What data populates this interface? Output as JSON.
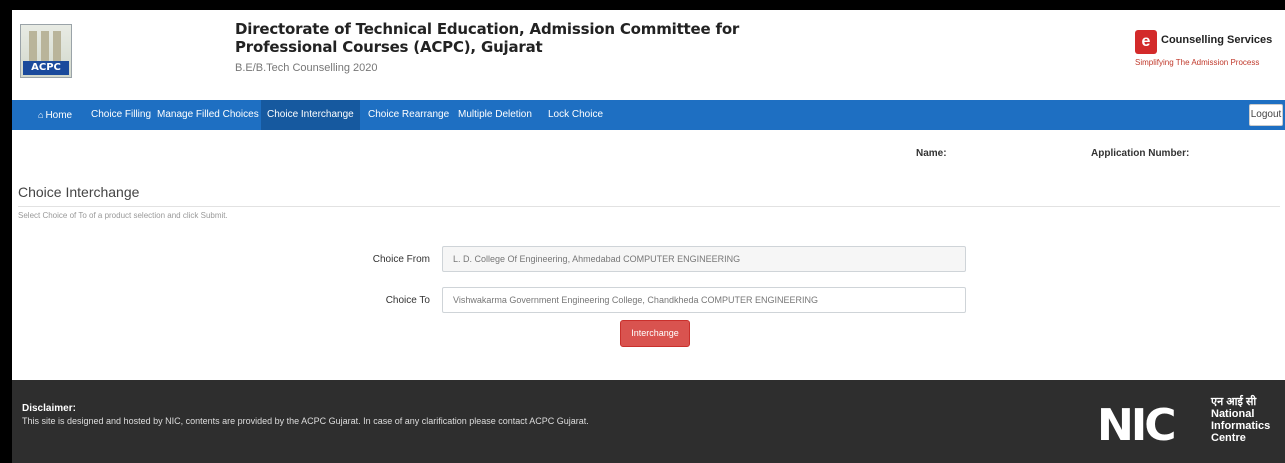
{
  "header": {
    "logo_text": "ACPC",
    "title_line1": "Directorate of Technical Education, Admission Committee for",
    "title_line2": "Professional Courses (ACPC), Gujarat",
    "subtitle": "B.E/B.Tech Counselling 2020",
    "service_badge": "e",
    "service_title": "Counselling Services",
    "service_tagline": "Simplifying The Admission Process"
  },
  "nav": {
    "items": [
      {
        "label": "Home",
        "icon": "home-icon"
      },
      {
        "label": "Choice Filling"
      },
      {
        "label": "Manage Filled Choices"
      },
      {
        "label": "Choice Interchange"
      },
      {
        "label": "Choice Rearrange"
      },
      {
        "label": "Multiple Deletion"
      },
      {
        "label": "Lock Choice"
      }
    ],
    "logout_label": "Logout",
    "accent": "#1e6fc2"
  },
  "candidate": {
    "name_label": "Name:",
    "application_label": "Application Number:"
  },
  "main": {
    "section_title": "Choice Interchange",
    "hint": "Select Choice of To of a product selection and click Submit.",
    "choice_from_label": "Choice From",
    "choice_from_value": "L. D. College Of Engineering, Ahmedabad COMPUTER ENGINEERING",
    "choice_to_label": "Choice To",
    "choice_to_value": "Vishwakarma Government Engineering College, Chandkheda COMPUTER ENGINEERING",
    "interchange_label": "Interchange",
    "button_color": "#d9534f"
  },
  "footer": {
    "disclaimer_title": "Disclaimer:",
    "disclaimer_text": "This site is designed and hosted by NIC, contents are provided by the ACPC Gujarat. In case of any clarification please contact ACPC Gujarat.",
    "nic_mark": "NIC",
    "nic_hindi": "एन आई सी",
    "nic_line1": "National",
    "nic_line2": "Informatics",
    "nic_line3": "Centre"
  }
}
